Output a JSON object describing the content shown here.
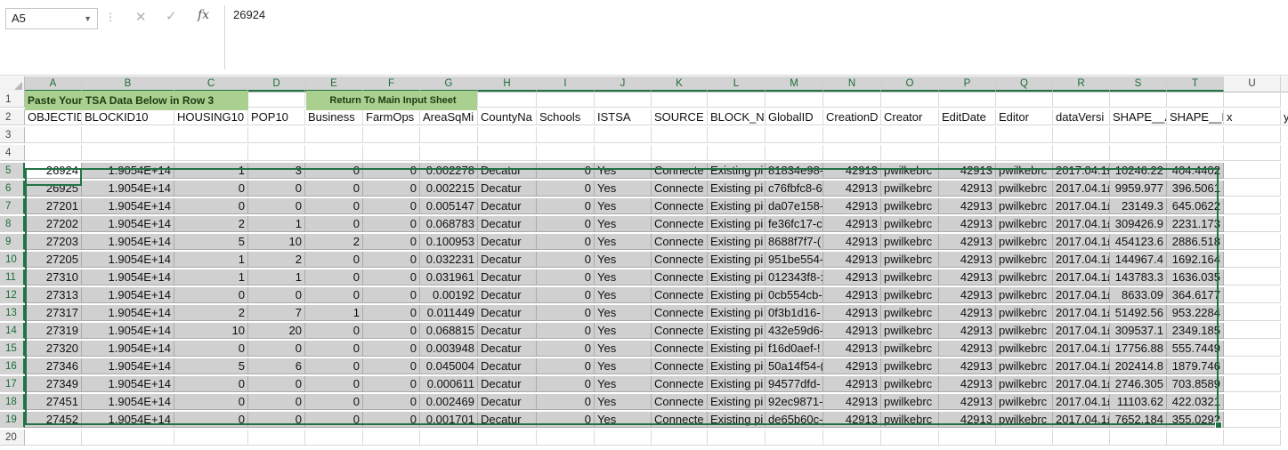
{
  "formula_bar": {
    "name_box": "A5",
    "content": "26924",
    "cancel_glyph": "✕",
    "enter_glyph": "✓",
    "fx_label": "fx"
  },
  "columns": [
    "A",
    "B",
    "C",
    "D",
    "E",
    "F",
    "G",
    "H",
    "I",
    "J",
    "K",
    "L",
    "M",
    "N",
    "O",
    "P",
    "Q",
    "R",
    "S",
    "T",
    "U"
  ],
  "row_numbers": [
    "1",
    "2",
    "3",
    "4",
    "5",
    "6",
    "7",
    "8",
    "9",
    "10",
    "11",
    "12",
    "13",
    "14",
    "15",
    "16",
    "17",
    "18",
    "19",
    "20"
  ],
  "row1": {
    "paste_button": "Paste Your TSA Data Below in Row 3",
    "return_button": "Return To Main Input Sheet"
  },
  "headers": [
    "OBJECTID",
    "BLOCKID10",
    "HOUSING10",
    "POP10",
    "Business",
    "FarmOps",
    "AreaSqMi",
    "CountyNa",
    "Schools",
    "ISTSA",
    "SOURCE",
    "BLOCK_NC",
    "GlobalID",
    "CreationD",
    "Creator",
    "EditDate",
    "Editor",
    "dataVersi",
    "SHAPE__A",
    "SHAPE__L",
    "x",
    "y"
  ],
  "rows": [
    [
      "26924",
      "1.9054E+14",
      "1",
      "3",
      "0",
      "0",
      "0.002278",
      "Decatur",
      "0",
      "Yes",
      "Connecte",
      "Existing pi",
      "81834e98-",
      "42913",
      "pwilkebrc",
      "42913",
      "pwilkebrc",
      "2017.04.1£",
      "10246.22",
      "404.4402"
    ],
    [
      "26925",
      "1.9054E+14",
      "0",
      "0",
      "0",
      "0",
      "0.002215",
      "Decatur",
      "0",
      "Yes",
      "Connecte",
      "Existing pi",
      "c76fbfc8-6",
      "42913",
      "pwilkebrc",
      "42913",
      "pwilkebrc",
      "2017.04.1£",
      "9959.977",
      "396.5061"
    ],
    [
      "27201",
      "1.9054E+14",
      "0",
      "0",
      "0",
      "0",
      "0.005147",
      "Decatur",
      "0",
      "Yes",
      "Connecte",
      "Existing pi",
      "da07e158-",
      "42913",
      "pwilkebrc",
      "42913",
      "pwilkebrc",
      "2017.04.1£",
      "23149.3",
      "645.0622"
    ],
    [
      "27202",
      "1.9054E+14",
      "2",
      "1",
      "0",
      "0",
      "0.068783",
      "Decatur",
      "0",
      "Yes",
      "Connecte",
      "Existing pi",
      "fe36fc17-c",
      "42913",
      "pwilkebrc",
      "42913",
      "pwilkebrc",
      "2017.04.1£",
      "309426.9",
      "2231.173"
    ],
    [
      "27203",
      "1.9054E+14",
      "5",
      "10",
      "2",
      "0",
      "0.100953",
      "Decatur",
      "0",
      "Yes",
      "Connecte",
      "Existing pi",
      "8688f7f7-(",
      "42913",
      "pwilkebrc",
      "42913",
      "pwilkebrc",
      "2017.04.1£",
      "454123.6",
      "2886.518"
    ],
    [
      "27205",
      "1.9054E+14",
      "1",
      "2",
      "0",
      "0",
      "0.032231",
      "Decatur",
      "0",
      "Yes",
      "Connecte",
      "Existing pi",
      "951be554-",
      "42913",
      "pwilkebrc",
      "42913",
      "pwilkebrc",
      "2017.04.1£",
      "144967.4",
      "1692.164"
    ],
    [
      "27310",
      "1.9054E+14",
      "1",
      "1",
      "0",
      "0",
      "0.031961",
      "Decatur",
      "0",
      "Yes",
      "Connecte",
      "Existing pi",
      "012343f8-:",
      "42913",
      "pwilkebrc",
      "42913",
      "pwilkebrc",
      "2017.04.1£",
      "143783.3",
      "1636.035"
    ],
    [
      "27313",
      "1.9054E+14",
      "0",
      "0",
      "0",
      "0",
      "0.00192",
      "Decatur",
      "0",
      "Yes",
      "Connecte",
      "Existing pi",
      "0cb554cb-",
      "42913",
      "pwilkebrc",
      "42913",
      "pwilkebrc",
      "2017.04.1£",
      "8633.09",
      "364.6177"
    ],
    [
      "27317",
      "1.9054E+14",
      "2",
      "7",
      "1",
      "0",
      "0.011449",
      "Decatur",
      "0",
      "Yes",
      "Connecte",
      "Existing pi",
      "0f3b1d16-",
      "42913",
      "pwilkebrc",
      "42913",
      "pwilkebrc",
      "2017.04.1£",
      "51492.56",
      "953.2284"
    ],
    [
      "27319",
      "1.9054E+14",
      "10",
      "20",
      "0",
      "0",
      "0.068815",
      "Decatur",
      "0",
      "Yes",
      "Connecte",
      "Existing pi",
      "432e59d6-",
      "42913",
      "pwilkebrc",
      "42913",
      "pwilkebrc",
      "2017.04.1£",
      "309537.1",
      "2349.185"
    ],
    [
      "27320",
      "1.9054E+14",
      "0",
      "0",
      "0",
      "0",
      "0.003948",
      "Decatur",
      "0",
      "Yes",
      "Connecte",
      "Existing pi",
      "f16d0aef-!",
      "42913",
      "pwilkebrc",
      "42913",
      "pwilkebrc",
      "2017.04.1£",
      "17756.88",
      "555.7449"
    ],
    [
      "27346",
      "1.9054E+14",
      "5",
      "6",
      "0",
      "0",
      "0.045004",
      "Decatur",
      "0",
      "Yes",
      "Connecte",
      "Existing pi",
      "50a14f54-(",
      "42913",
      "pwilkebrc",
      "42913",
      "pwilkebrc",
      "2017.04.1£",
      "202414.8",
      "1879.746"
    ],
    [
      "27349",
      "1.9054E+14",
      "0",
      "0",
      "0",
      "0",
      "0.000611",
      "Decatur",
      "0",
      "Yes",
      "Connecte",
      "Existing pi",
      "94577dfd-",
      "42913",
      "pwilkebrc",
      "42913",
      "pwilkebrc",
      "2017.04.1£",
      "2746.305",
      "703.8589"
    ],
    [
      "27451",
      "1.9054E+14",
      "0",
      "0",
      "0",
      "0",
      "0.002469",
      "Decatur",
      "0",
      "Yes",
      "Connecte",
      "Existing pi",
      "92ec9871-",
      "42913",
      "pwilkebrc",
      "42913",
      "pwilkebrc",
      "2017.04.1£",
      "11103.62",
      "422.0321"
    ],
    [
      "27452",
      "1.9054E+14",
      "0",
      "0",
      "0",
      "0",
      "0.001701",
      "Decatur",
      "0",
      "Yes",
      "Connecte",
      "Existing pi",
      "de65b60c-",
      "42913",
      "pwilkebrc",
      "42913",
      "pwilkebrc",
      "2017.04.1£",
      "7652.184",
      "355.0292"
    ]
  ]
}
